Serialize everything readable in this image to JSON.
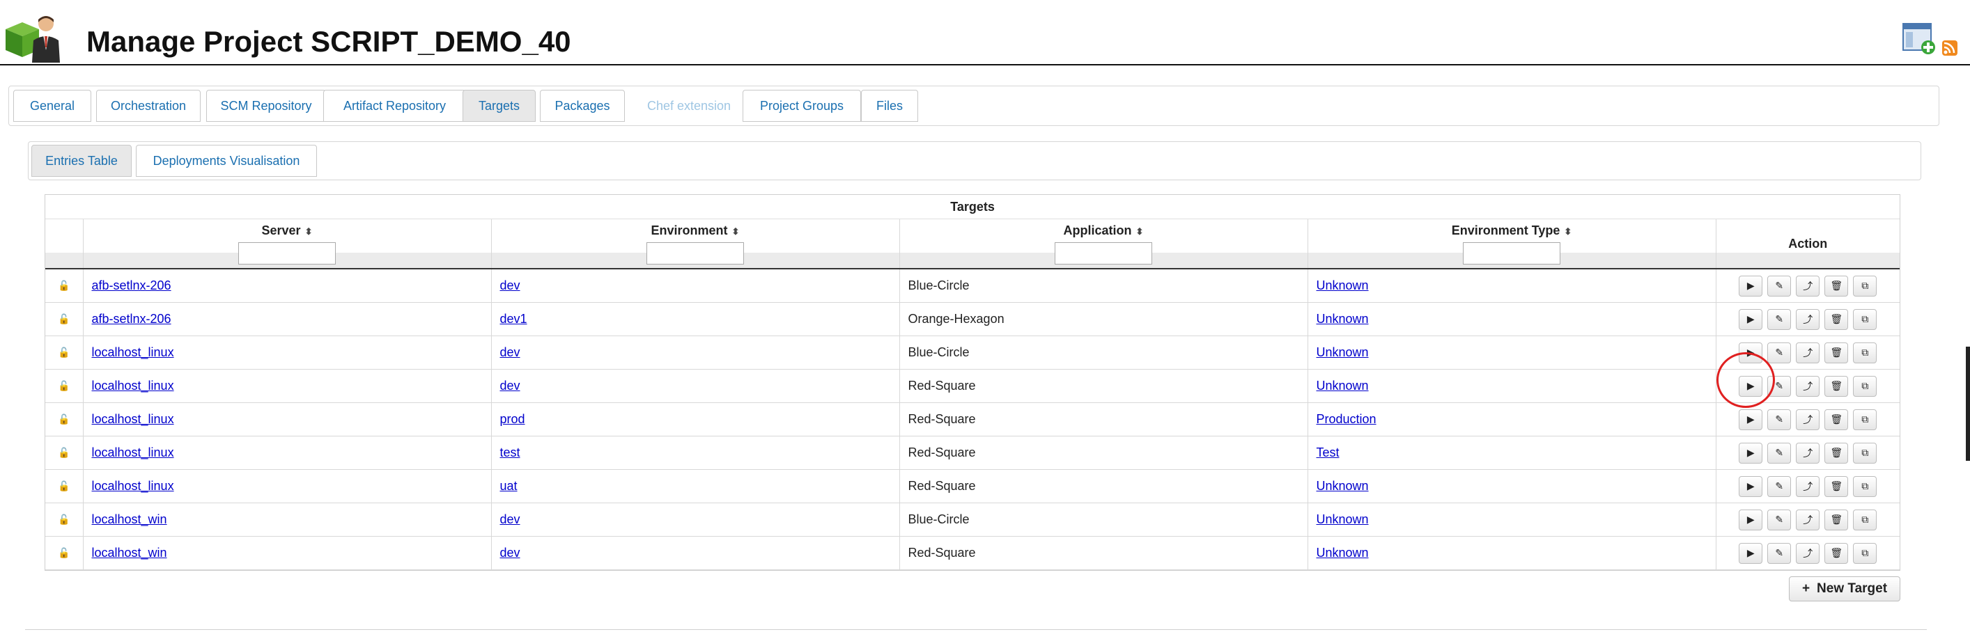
{
  "header": {
    "title": "Manage Project SCRIPT_DEMO_40",
    "logo_icon": "project-manager-avatar-icon",
    "right_icons": [
      "new-window-icon",
      "rss-feed-icon"
    ]
  },
  "main_tabs": [
    {
      "label": "General",
      "state": "normal"
    },
    {
      "label": "Orchestration",
      "state": "normal"
    },
    {
      "label": "SCM Repository",
      "state": "normal"
    },
    {
      "label": "Artifact Repository",
      "state": "normal"
    },
    {
      "label": "Targets",
      "state": "active"
    },
    {
      "label": "Packages",
      "state": "normal"
    },
    {
      "label": "Chef extension",
      "state": "disabled"
    },
    {
      "label": "Project Groups",
      "state": "normal"
    },
    {
      "label": "Files",
      "state": "normal"
    }
  ],
  "sub_tabs": [
    {
      "label": "Entries Table",
      "state": "active"
    },
    {
      "label": "Deployments Visualisation",
      "state": "normal"
    }
  ],
  "table": {
    "caption": "Targets",
    "columns": {
      "server": "Server",
      "environment": "Environment",
      "application": "Application",
      "environment_type": "Environment Type",
      "action": "Action"
    },
    "sort_icon": "⬍",
    "rows": [
      {
        "server": "afb-setlnx-206",
        "environment": "dev",
        "application": "Blue-Circle",
        "environment_type": "Unknown"
      },
      {
        "server": "afb-setlnx-206",
        "environment": "dev1",
        "application": "Orange-Hexagon",
        "environment_type": "Unknown"
      },
      {
        "server": "localhost_linux",
        "environment": "dev",
        "application": "Blue-Circle",
        "environment_type": "Unknown"
      },
      {
        "server": "localhost_linux",
        "environment": "dev",
        "application": "Red-Square",
        "environment_type": "Unknown"
      },
      {
        "server": "localhost_linux",
        "environment": "prod",
        "application": "Red-Square",
        "environment_type": "Production"
      },
      {
        "server": "localhost_linux",
        "environment": "test",
        "application": "Red-Square",
        "environment_type": "Test"
      },
      {
        "server": "localhost_linux",
        "environment": "uat",
        "application": "Red-Square",
        "environment_type": "Unknown"
      },
      {
        "server": "localhost_win",
        "environment": "dev",
        "application": "Blue-Circle",
        "environment_type": "Unknown"
      },
      {
        "server": "localhost_win",
        "environment": "dev",
        "application": "Red-Square",
        "environment_type": "Unknown"
      }
    ],
    "row_actions": [
      {
        "name": "deploy-button",
        "glyph": "▶"
      },
      {
        "name": "edit-button",
        "glyph": "✎"
      },
      {
        "name": "promote-button",
        "glyph": "⤴"
      },
      {
        "name": "delete-button",
        "glyph": "🗑"
      },
      {
        "name": "copy-button",
        "glyph": "⧉"
      }
    ],
    "lock_glyph": "🔓"
  },
  "new_target_button": {
    "plus": "+",
    "label": "New Target"
  },
  "colors": {
    "link": "#0000cc",
    "tab_text": "#1a6fb0",
    "highlight": "#e02020"
  }
}
